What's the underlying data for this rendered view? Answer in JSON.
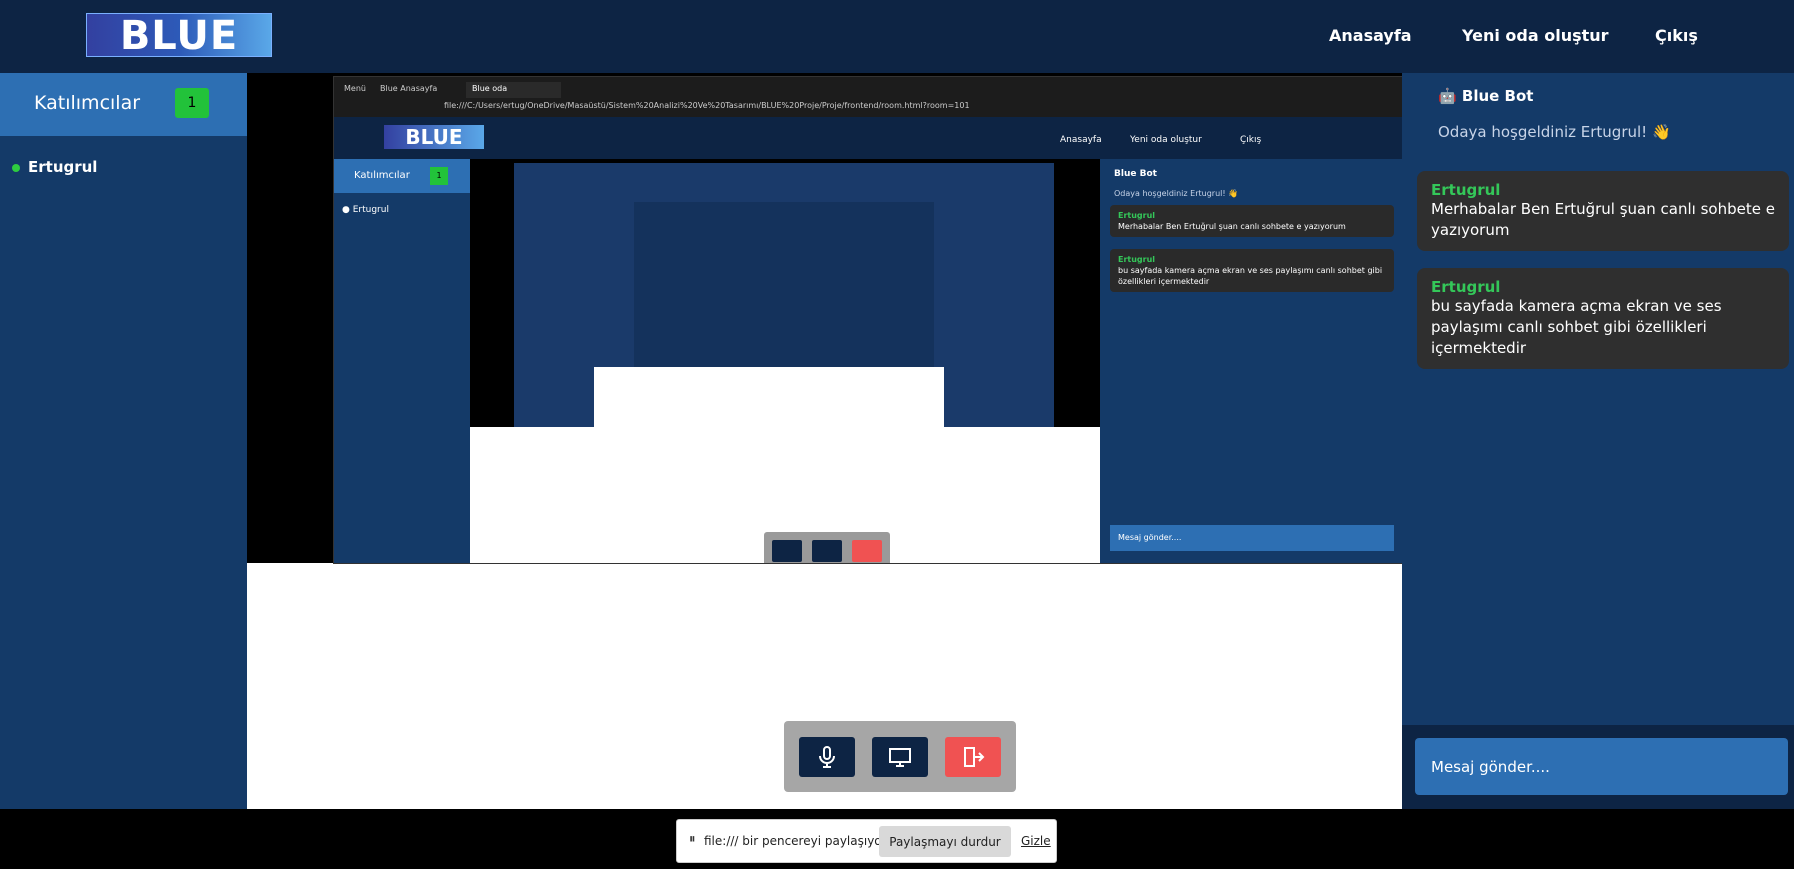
{
  "header": {
    "logo_text": "BLUE",
    "nav": {
      "home": "Anasayfa",
      "new_room": "Yeni oda oluştur",
      "exit": "Çıkış"
    }
  },
  "participants": {
    "title": "Katılımcılar",
    "count": "1",
    "items": [
      {
        "name": "Ertugrul",
        "status_color": "#2ecc40"
      }
    ]
  },
  "shared_screen": {
    "tabs": [
      "Menü",
      "Blue Anasayfa",
      "Blue oda"
    ],
    "url": "file:///C:/Users/ertug/OneDrive/Masaüstü/Sistem%20Analizi%20Ve%20Tasarımı/BLUE%20Proje/Proje/frontend/room.html?room=101",
    "logo_text": "BLUE",
    "nav": [
      "Anasayfa",
      "Yeni oda oluştur",
      "Çıkış"
    ],
    "participants_title": "Katılımcılar",
    "participants_count": "1",
    "participant": "Ertugrul",
    "bot_name": "Blue Bot",
    "welcome": "Odaya hoşgeldiniz Ertugrul! 👋",
    "messages": [
      {
        "author": "Ertugrul",
        "text": "Merhabalar Ben Ertuğrul şuan canlı sohbete e yazıyorum"
      },
      {
        "author": "Ertugrul",
        "text": "bu sayfada kamera açma ekran ve ses paylaşımı canlı sohbet gibi özellikleri içermektedir"
      }
    ],
    "input_placeholder": "Mesaj gönder...."
  },
  "controls": {
    "mic_icon": "microphone-icon",
    "screen_icon": "monitor-icon",
    "leave_icon": "leave-icon"
  },
  "chat": {
    "bot_name": "Blue Bot",
    "bot_icon": "robot-icon",
    "welcome": "Odaya hoşgeldiniz Ertugrul! 👋",
    "messages": [
      {
        "author": "Ertugrul",
        "text": "Merhabalar Ben Ertuğrul şuan canlı sohbete e yazıyorum"
      },
      {
        "author": "Ertugrul",
        "text": "bu sayfada kamera açma ekran ve ses paylaşımı canlı sohbet gibi özellikleri içermektedir"
      }
    ],
    "input_placeholder": "Mesaj gönder...."
  },
  "share_bar": {
    "text": "file:/// bir pencereyi paylaşıyor.",
    "stop_label": "Paylaşmayı durdur",
    "hide_label": "Gizle"
  },
  "colors": {
    "header_bg": "#0d2444",
    "panel_bg": "#143a68",
    "accent_blue": "#2d6fb3",
    "online_green": "#2ecc40",
    "leave_red": "#f05252"
  }
}
